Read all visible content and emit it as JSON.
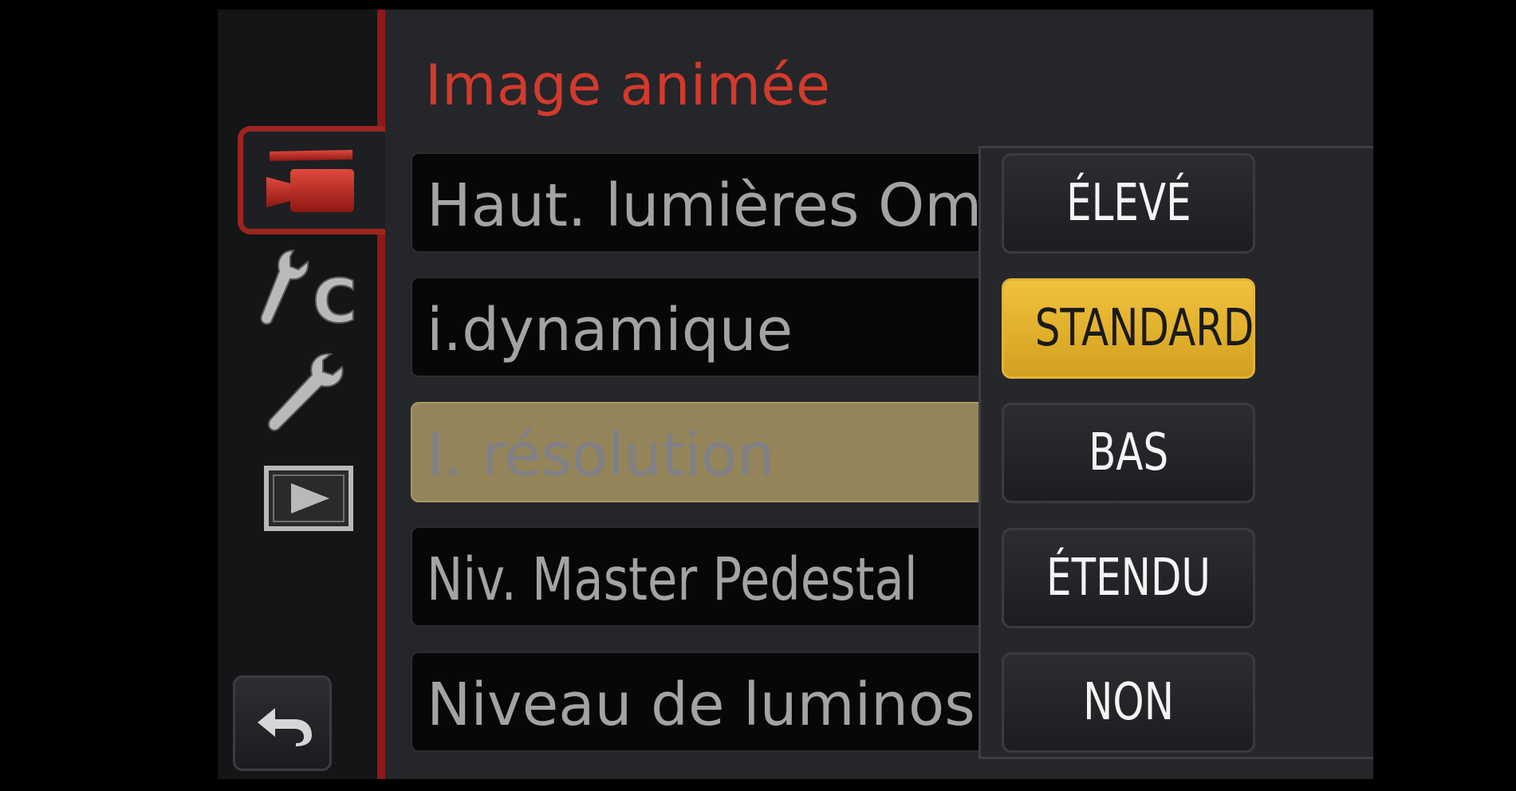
{
  "menu": {
    "title": "Image animée",
    "items": [
      {
        "label": "Haut. lumières Omb"
      },
      {
        "label": "i.dynamique"
      },
      {
        "label": "I. résolution"
      },
      {
        "label": "Niv. Master Pedestal"
      },
      {
        "label": "Niveau de luminosit"
      }
    ],
    "selected_index": 2
  },
  "sidebar": {
    "tabs": [
      {
        "icon": "motion-picture-camera-icon",
        "active": true
      },
      {
        "icon": "custom-wrench-c-icon",
        "active": false
      },
      {
        "icon": "setup-wrench-icon",
        "active": false
      },
      {
        "icon": "playback-icon",
        "active": false
      }
    ],
    "back_icon": "return-arrow-icon"
  },
  "options": {
    "items": [
      {
        "label": "ÉLEVÉ"
      },
      {
        "label": "STANDARD"
      },
      {
        "label": "BAS"
      },
      {
        "label": "ÉTENDU"
      },
      {
        "label": "NON"
      }
    ],
    "selected_index": 1
  },
  "colors": {
    "accent_red": "#d23a2c",
    "highlight_gold": "#e2b33a",
    "selected_row": "#94845a"
  }
}
